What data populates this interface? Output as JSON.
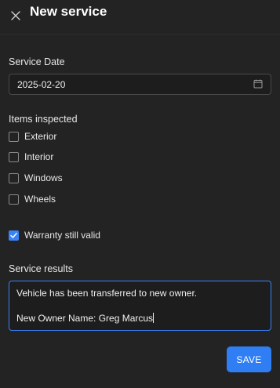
{
  "header": {
    "title": "New service",
    "close_icon": "close-icon"
  },
  "service_date": {
    "label": "Service Date",
    "value": "2025-02-20",
    "icon": "calendar-icon"
  },
  "items_inspected": {
    "label": "Items inspected",
    "items": [
      {
        "label": "Exterior",
        "checked": false
      },
      {
        "label": "Interior",
        "checked": false
      },
      {
        "label": "Windows",
        "checked": false
      },
      {
        "label": "Wheels",
        "checked": false
      }
    ]
  },
  "warranty": {
    "label": "Warranty still valid",
    "checked": true
  },
  "service_results": {
    "label": "Service results",
    "lines": [
      "Vehicle has been transferred to new owner.",
      "",
      "New Owner Name: Greg Marcus"
    ]
  },
  "actions": {
    "save_label": "SAVE"
  },
  "colors": {
    "accent": "#2f7ef4",
    "background": "#232323"
  }
}
